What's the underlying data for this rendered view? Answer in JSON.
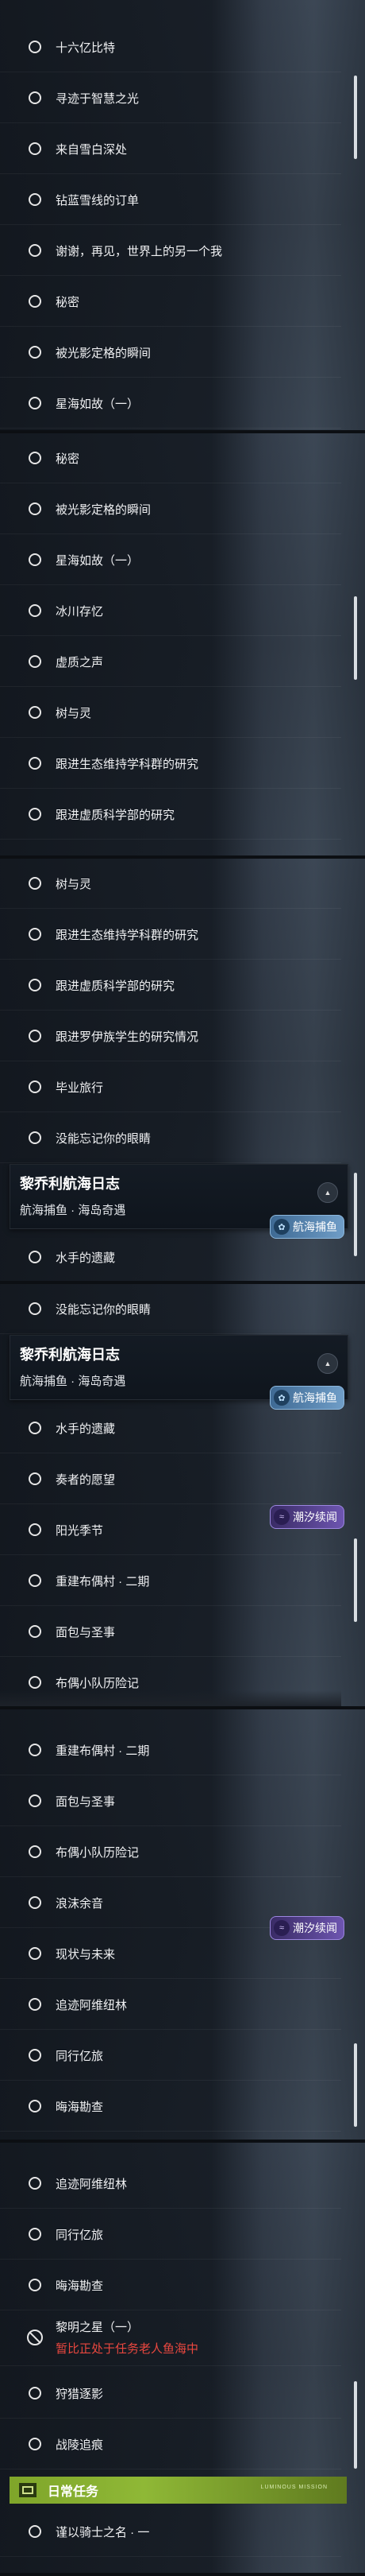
{
  "panels": [
    {
      "items": [
        "十六亿比特",
        "寻迹于智慧之光",
        "来自雪白深处",
        "钻蓝雪线的订单",
        "谢谢，再见，世界上的另一个我",
        "秘密",
        "被光影定格的瞬间",
        "星海如故（一）"
      ]
    },
    {
      "items": [
        "秘密",
        "被光影定格的瞬间",
        "星海如故（一）",
        "冰川存忆",
        "虚质之声",
        "树与灵",
        "跟进生态维持学科群的研究",
        "跟进虚质科学部的研究"
      ]
    },
    {
      "items": [
        "树与灵",
        "跟进生态维持学科群的研究",
        "跟进虚质科学部的研究",
        "跟进罗伊族学生的研究情况",
        "毕业旅行",
        "没能忘记你的眼睛"
      ]
    },
    {
      "items": [
        "水手的遗藏",
        "没能忘记你的眼睛"
      ]
    },
    {
      "items": [
        "水手的遗藏",
        "奏者的愿望",
        "阳光季节",
        "重建布偶村 · 二期",
        "面包与圣事",
        "布偶小队历险记"
      ]
    },
    {
      "items": [
        "重建布偶村 · 二期",
        "面包与圣事",
        "布偶小队历险记",
        "浪沫余音",
        "现状与未来",
        "追迹阿维纽林",
        "同行亿旅",
        "晦海勘查"
      ]
    },
    {
      "items": [
        "追迹阿维纽林",
        "同行亿旅",
        "晦海勘查",
        "黎明之星（一）",
        "狩猎逐影",
        "战陵追痕",
        "谨以骑士之名 · 一"
      ]
    }
  ],
  "chapter_header": {
    "title": "黎乔利航海日志",
    "subtitle": "航海捕鱼 · 海岛奇遇"
  },
  "badges": {
    "sailing": "航海捕鱼",
    "tide": "潮汐续闻"
  },
  "locked_note": "暂比正处于任务老人鱼海中",
  "daily_section": {
    "label": "日常任务",
    "deco": "LUMINOUS MISSION"
  },
  "colors": {
    "locked_note": "#e8473f",
    "daily_bar": "#8fb836",
    "badge_blue": "#5a89b5",
    "badge_purple": "#5b479e"
  }
}
